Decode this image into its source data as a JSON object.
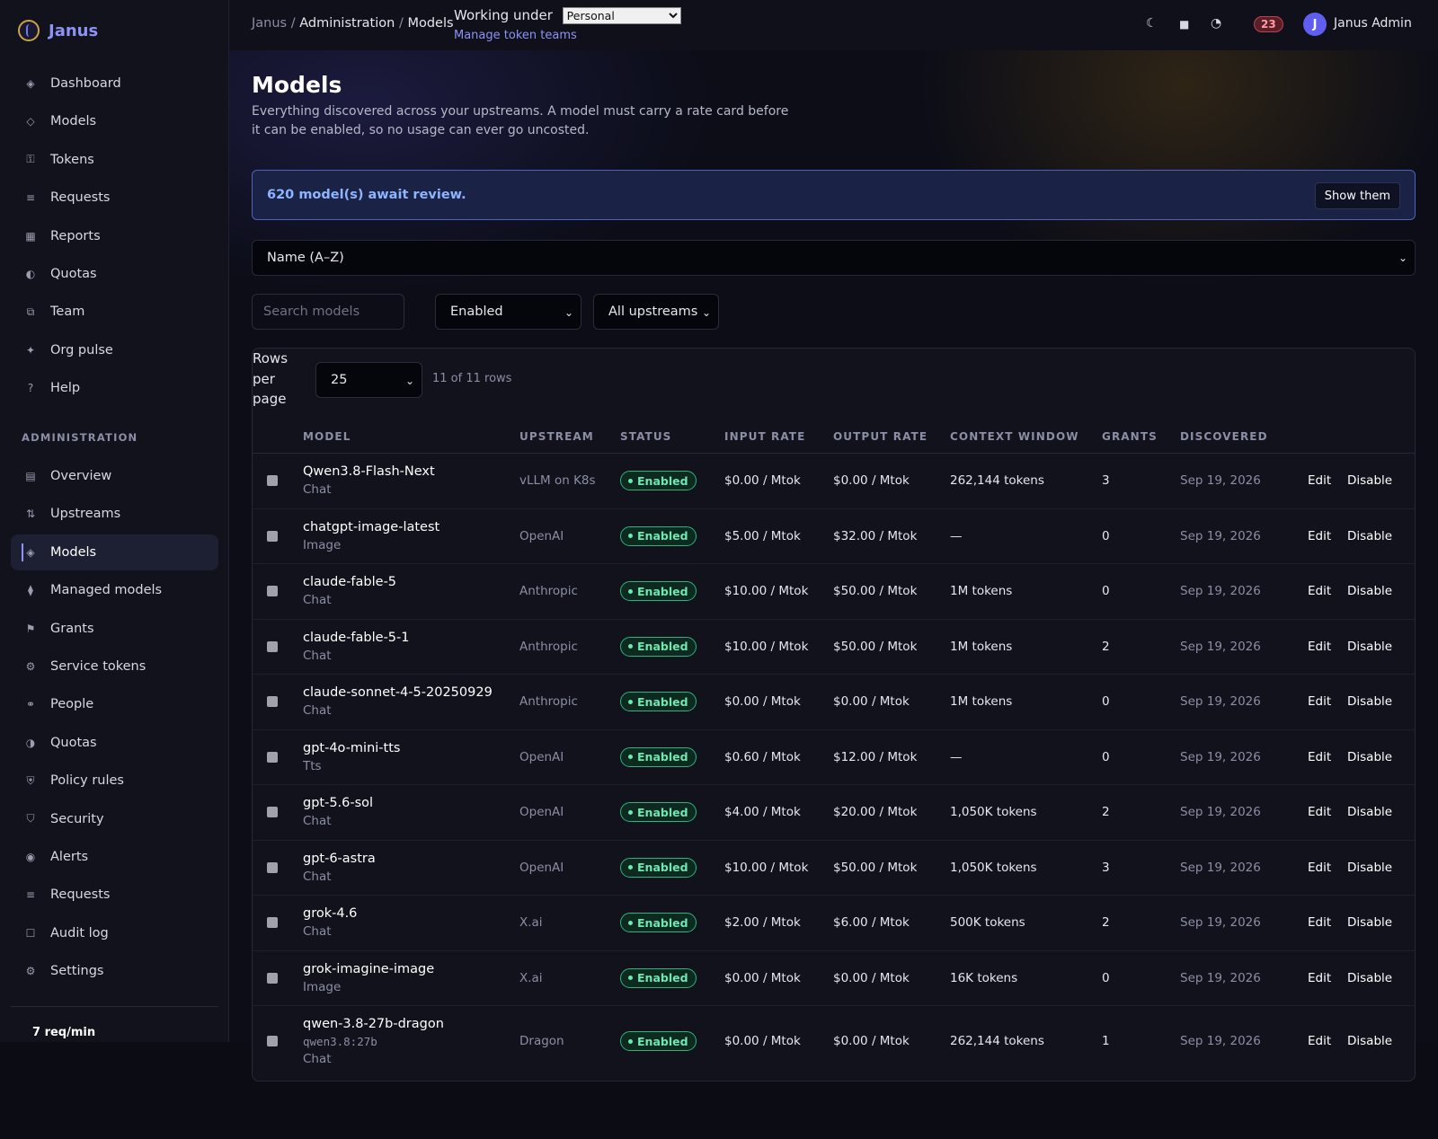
{
  "app": {
    "name": "Janus"
  },
  "sidebar": {
    "primary": [
      {
        "label": "Dashboard",
        "icon": "◈"
      },
      {
        "label": "Models",
        "icon": "◇"
      },
      {
        "label": "Tokens",
        "icon": "⚿"
      },
      {
        "label": "Requests",
        "icon": "≡"
      },
      {
        "label": "Reports",
        "icon": "▦"
      },
      {
        "label": "Quotas",
        "icon": "◐"
      },
      {
        "label": "Team",
        "icon": "⧉"
      },
      {
        "label": "Org pulse",
        "icon": "✦"
      },
      {
        "label": "Help",
        "icon": "?"
      }
    ],
    "section_label": "ADMINISTRATION",
    "admin": [
      {
        "label": "Overview",
        "icon": "▤"
      },
      {
        "label": "Upstreams",
        "icon": "⇅"
      },
      {
        "label": "Models",
        "icon": "◈"
      },
      {
        "label": "Managed models",
        "icon": "⧫"
      },
      {
        "label": "Grants",
        "icon": "⚑"
      },
      {
        "label": "Service tokens",
        "icon": "⚙"
      },
      {
        "label": "People",
        "icon": "⚭"
      },
      {
        "label": "Quotas",
        "icon": "◑"
      },
      {
        "label": "Policy rules",
        "icon": "⛨"
      },
      {
        "label": "Security",
        "icon": "⛉"
      },
      {
        "label": "Alerts",
        "icon": "◉"
      },
      {
        "label": "Requests",
        "icon": "≡"
      },
      {
        "label": "Audit log",
        "icon": "☐"
      },
      {
        "label": "Settings",
        "icon": "⚙"
      }
    ],
    "active_admin_index": 2,
    "footer_rate": "7 req/min"
  },
  "topbar": {
    "breadcrumb": {
      "root": "Janus",
      "sep": "/",
      "section": "Administration",
      "current": "Models"
    },
    "working_under_label": "Working under",
    "working_under_value": "Personal",
    "manage_link": "Manage token teams",
    "notification_count": "23",
    "user_initial": "J",
    "user_name": "Janus Admin"
  },
  "page": {
    "title": "Models",
    "description": "Everything discovered across your upstreams. A model must carry a rate card before it can be enabled, so no usage can ever go uncosted.",
    "review_banner": "620 model(s) await review.",
    "review_button": "Show them",
    "sort_value": "Name (A–Z)",
    "search_placeholder": "Search models",
    "status_filter": "Enabled",
    "upstream_filter": "All upstreams",
    "rows_per_page_label": "Rows per page",
    "rows_per_page_value": "25",
    "row_count": "11 of 11 rows"
  },
  "table": {
    "headers": [
      "MODEL",
      "UPSTREAM",
      "STATUS",
      "INPUT RATE",
      "OUTPUT RATE",
      "CONTEXT WINDOW",
      "GRANTS",
      "DISCOVERED"
    ],
    "edit_label": "Edit",
    "disable_label": "Disable",
    "rows": [
      {
        "name": "Qwen3.8-Flash-Next",
        "type": "Chat",
        "alias": "",
        "upstream": "vLLM on K8s",
        "status": "Enabled",
        "input": "$0.00 / Mtok",
        "output": "$0.00 / Mtok",
        "context": "262,144 tokens",
        "grants": "3",
        "discovered": "Sep 19, 2026"
      },
      {
        "name": "chatgpt-image-latest",
        "type": "Image",
        "alias": "",
        "upstream": "OpenAI",
        "status": "Enabled",
        "input": "$5.00 / Mtok",
        "output": "$32.00 / Mtok",
        "context": "—",
        "grants": "0",
        "discovered": "Sep 19, 2026"
      },
      {
        "name": "claude-fable-5",
        "type": "Chat",
        "alias": "",
        "upstream": "Anthropic",
        "status": "Enabled",
        "input": "$10.00 / Mtok",
        "output": "$50.00 / Mtok",
        "context": "1M tokens",
        "grants": "0",
        "discovered": "Sep 19, 2026"
      },
      {
        "name": "claude-fable-5-1",
        "type": "Chat",
        "alias": "",
        "upstream": "Anthropic",
        "status": "Enabled",
        "input": "$10.00 / Mtok",
        "output": "$50.00 / Mtok",
        "context": "1M tokens",
        "grants": "2",
        "discovered": "Sep 19, 2026"
      },
      {
        "name": "claude-sonnet-4-5-20250929",
        "type": "Chat",
        "alias": "",
        "upstream": "Anthropic",
        "status": "Enabled",
        "input": "$0.00 / Mtok",
        "output": "$0.00 / Mtok",
        "context": "1M tokens",
        "grants": "0",
        "discovered": "Sep 19, 2026"
      },
      {
        "name": "gpt-4o-mini-tts",
        "type": "Tts",
        "alias": "",
        "upstream": "OpenAI",
        "status": "Enabled",
        "input": "$0.60 / Mtok",
        "output": "$12.00 / Mtok",
        "context": "—",
        "grants": "0",
        "discovered": "Sep 19, 2026"
      },
      {
        "name": "gpt-5.6-sol",
        "type": "Chat",
        "alias": "",
        "upstream": "OpenAI",
        "status": "Enabled",
        "input": "$4.00 / Mtok",
        "output": "$20.00 / Mtok",
        "context": "1,050K tokens",
        "grants": "2",
        "discovered": "Sep 19, 2026"
      },
      {
        "name": "gpt-6-astra",
        "type": "Chat",
        "alias": "",
        "upstream": "OpenAI",
        "status": "Enabled",
        "input": "$10.00 / Mtok",
        "output": "$50.00 / Mtok",
        "context": "1,050K tokens",
        "grants": "3",
        "discovered": "Sep 19, 2026"
      },
      {
        "name": "grok-4.6",
        "type": "Chat",
        "alias": "",
        "upstream": "X.ai",
        "status": "Enabled",
        "input": "$2.00 / Mtok",
        "output": "$6.00 / Mtok",
        "context": "500K tokens",
        "grants": "2",
        "discovered": "Sep 19, 2026"
      },
      {
        "name": "grok-imagine-image",
        "type": "Image",
        "alias": "",
        "upstream": "X.ai",
        "status": "Enabled",
        "input": "$0.00 / Mtok",
        "output": "$0.00 / Mtok",
        "context": "16K tokens",
        "grants": "0",
        "discovered": "Sep 19, 2026"
      },
      {
        "name": "qwen-3.8-27b-dragon",
        "type": "Chat",
        "alias": "qwen3.8:27b",
        "upstream": "Dragon",
        "status": "Enabled",
        "input": "$0.00 / Mtok",
        "output": "$0.00 / Mtok",
        "context": "262,144 tokens",
        "grants": "1",
        "discovered": "Sep 19, 2026"
      }
    ]
  }
}
